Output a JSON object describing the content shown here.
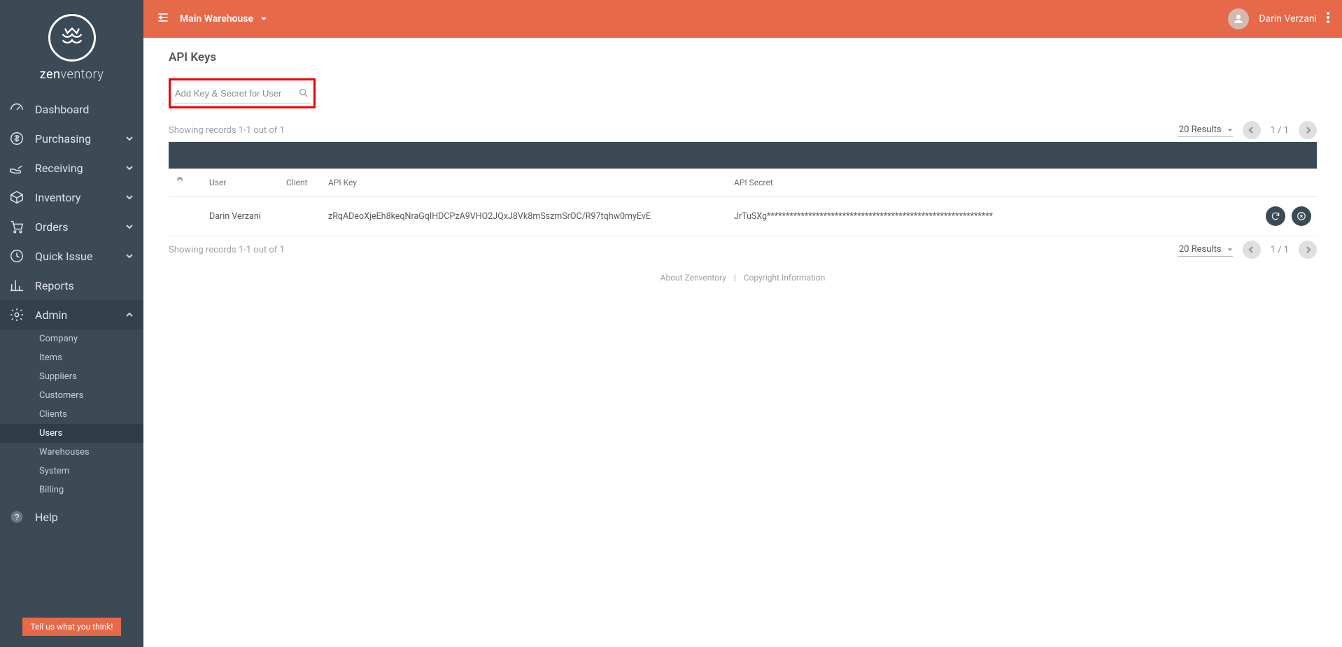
{
  "brand": {
    "bold": "zen",
    "rest": "ventory"
  },
  "sidebar": {
    "items": [
      {
        "label": "Dashboard",
        "expandable": false
      },
      {
        "label": "Purchasing",
        "expandable": true
      },
      {
        "label": "Receiving",
        "expandable": true
      },
      {
        "label": "Inventory",
        "expandable": true
      },
      {
        "label": "Orders",
        "expandable": true
      },
      {
        "label": "Quick Issue",
        "expandable": true
      },
      {
        "label": "Reports",
        "expandable": false
      },
      {
        "label": "Admin",
        "expandable": true,
        "expanded": true
      }
    ],
    "admin_sub": [
      {
        "label": "Company"
      },
      {
        "label": "Items"
      },
      {
        "label": "Suppliers"
      },
      {
        "label": "Customers"
      },
      {
        "label": "Clients"
      },
      {
        "label": "Users",
        "active": true
      },
      {
        "label": "Warehouses"
      },
      {
        "label": "System"
      },
      {
        "label": "Billing"
      }
    ],
    "help_label": "Help",
    "feedback_label": "Tell us what you think!"
  },
  "topbar": {
    "warehouse": "Main Warehouse",
    "user": "Darin Verzani"
  },
  "page": {
    "title": "API Keys",
    "search_placeholder": "Add Key & Secret for User",
    "records_text": "Showing records 1-1 out of 1",
    "results_label": "20 Results",
    "page_indicator": "1 / 1"
  },
  "table": {
    "headers": {
      "user": "User",
      "client": "Client",
      "api_key": "API Key",
      "api_secret": "API Secret"
    },
    "rows": [
      {
        "user": "Darin Verzani",
        "client": "",
        "api_key": "zRqADeoXjeEh8keqNraGqIHDCPzA9VHO2JQxJ8Vk8mSszmSrOC/R97tqhw0myEvE",
        "api_secret": "JrTuSXg************************************************************"
      }
    ]
  },
  "footer": {
    "about": "About Zenventory",
    "copyright": "Copyright Information"
  }
}
